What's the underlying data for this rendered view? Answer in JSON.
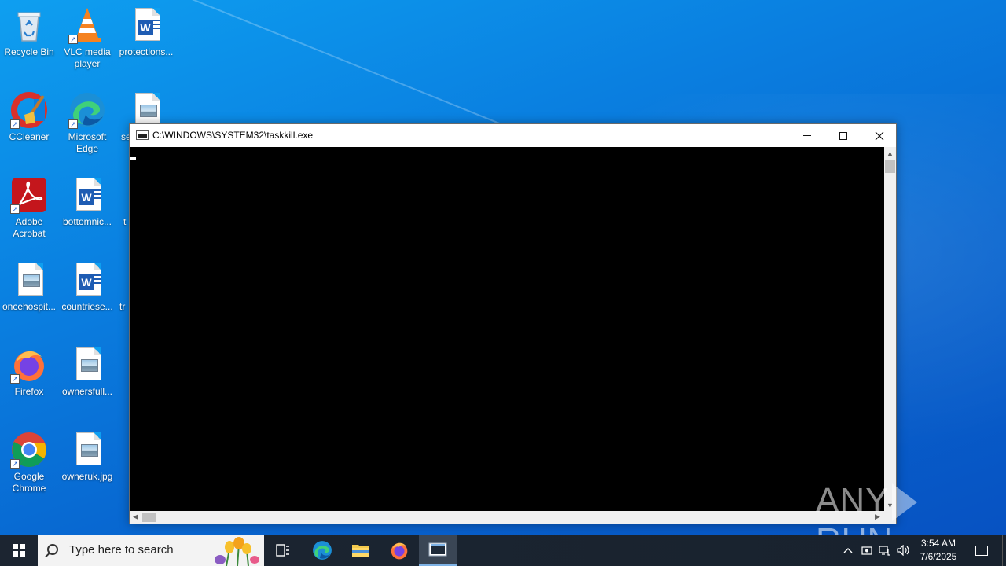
{
  "desktop": {
    "icons": [
      {
        "label": "Recycle Bin",
        "icon": "recycle-bin-icon"
      },
      {
        "label": "VLC media player",
        "icon": "vlc-icon"
      },
      {
        "label": "protections...",
        "icon": "word-document-icon"
      },
      {
        "label": "CCleaner",
        "icon": "ccleaner-icon"
      },
      {
        "label": "Microsoft Edge",
        "icon": "edge-icon"
      },
      {
        "label": "se",
        "icon": "image-file-icon"
      },
      {
        "label": "Adobe Acrobat",
        "icon": "acrobat-icon"
      },
      {
        "label": "bottomnic...",
        "icon": "word-document-icon"
      },
      {
        "label": "t",
        "icon": "image-file-icon"
      },
      {
        "label": "oncehospit...",
        "icon": "image-file-icon"
      },
      {
        "label": "countriese...",
        "icon": "word-document-icon"
      },
      {
        "label": "tr",
        "icon": "image-file-icon"
      },
      {
        "label": "Firefox",
        "icon": "firefox-icon"
      },
      {
        "label": "ownersfull...",
        "icon": "image-file-icon"
      },
      {
        "label": "Google Chrome",
        "icon": "chrome-icon"
      },
      {
        "label": "owneruk.jpg",
        "icon": "image-file-icon"
      }
    ]
  },
  "window": {
    "title": "C:\\WINDOWS\\SYSTEM32\\taskkill.exe",
    "console_text": ""
  },
  "watermark": {
    "left": "ANY",
    "right": "RUN"
  },
  "taskbar": {
    "search_placeholder": "Type here to search",
    "apps": [
      "task-view-icon",
      "edge-icon",
      "file-explorer-icon",
      "firefox-icon",
      "console-icon"
    ],
    "time": "3:54 AM",
    "date": "7/6/2025"
  },
  "colors": {
    "desktop": "#0a7fe0",
    "taskbar": "#1b2838",
    "console_bg": "#000000"
  }
}
